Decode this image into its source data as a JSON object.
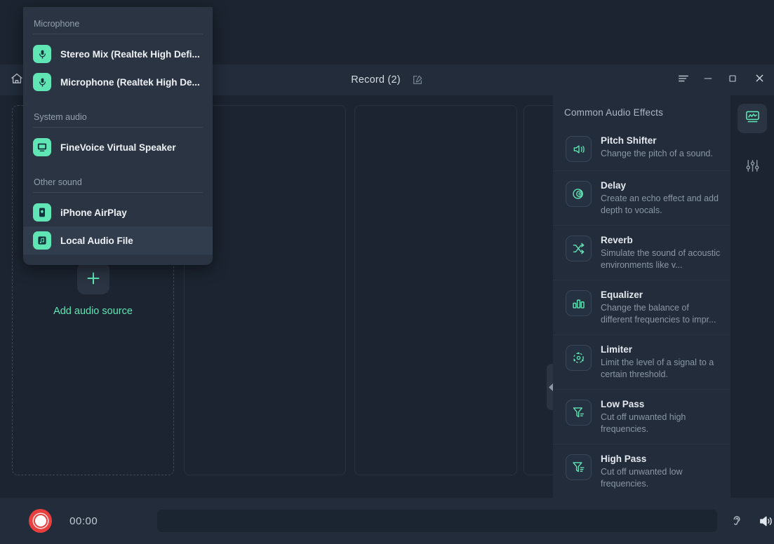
{
  "window": {
    "title": "Record (2)",
    "home_icon": "home-icon",
    "edit_icon": "edit-pencil-icon",
    "menu_icon": "menu-lines-icon",
    "minimize_icon": "minimize-icon",
    "maximize_icon": "maximize-icon",
    "close_icon": "close-icon"
  },
  "sources": {
    "add_label": "Add audio source",
    "add_icon": "plus-icon"
  },
  "effects": {
    "title": "Common Audio Effects",
    "items": [
      {
        "name": "Pitch Shifter",
        "desc": "Change the pitch of a sound.",
        "icon": "speaker-pitch-icon"
      },
      {
        "name": "Delay",
        "desc": "Create an echo effect and add depth to vocals.",
        "icon": "echo-circles-icon"
      },
      {
        "name": "Reverb",
        "desc": "Simulate the sound of acoustic environments like v...",
        "icon": "shuffle-arrows-icon"
      },
      {
        "name": "Equalizer",
        "desc": "Change the balance of different frequencies to impr...",
        "icon": "bar-levels-icon"
      },
      {
        "name": "Limiter",
        "desc": "Limit the level of a signal to a certain threshold.",
        "icon": "dashed-circle-icon"
      },
      {
        "name": "Low Pass",
        "desc": "Cut off unwanted high frequencies.",
        "icon": "funnel-low-icon"
      },
      {
        "name": "High Pass",
        "desc": "Cut off unwanted low frequencies.",
        "icon": "funnel-high-icon"
      }
    ]
  },
  "rail": {
    "items": [
      {
        "icon": "waveform-monitor-icon",
        "active": true
      },
      {
        "icon": "mixer-sliders-icon",
        "active": false
      }
    ]
  },
  "transport": {
    "record_icon": "record-circle-icon",
    "timer": "00:00",
    "monitor_icon": "ear-monitor-icon",
    "volume_icon": "speaker-volume-icon"
  },
  "dropdown": {
    "groups": [
      {
        "label": "Microphone",
        "items": [
          {
            "label": "Stereo Mix (Realtek High Defi...",
            "icon": "microphone-icon",
            "hovered": false
          },
          {
            "label": "Microphone (Realtek High De...",
            "icon": "microphone-icon",
            "hovered": false
          }
        ]
      },
      {
        "label": "System audio",
        "items": [
          {
            "label": "FineVoice Virtual Speaker",
            "icon": "monitor-icon",
            "hovered": false
          }
        ]
      },
      {
        "label": "Other sound",
        "items": [
          {
            "label": "iPhone AirPlay",
            "icon": "iphone-icon",
            "hovered": false
          },
          {
            "label": "Local Audio File",
            "icon": "music-file-icon",
            "hovered": true
          }
        ]
      }
    ]
  },
  "colors": {
    "accent": "#5fe6b4",
    "record": "#e8403f",
    "panel": "#222c3a",
    "background": "#1b2430"
  }
}
